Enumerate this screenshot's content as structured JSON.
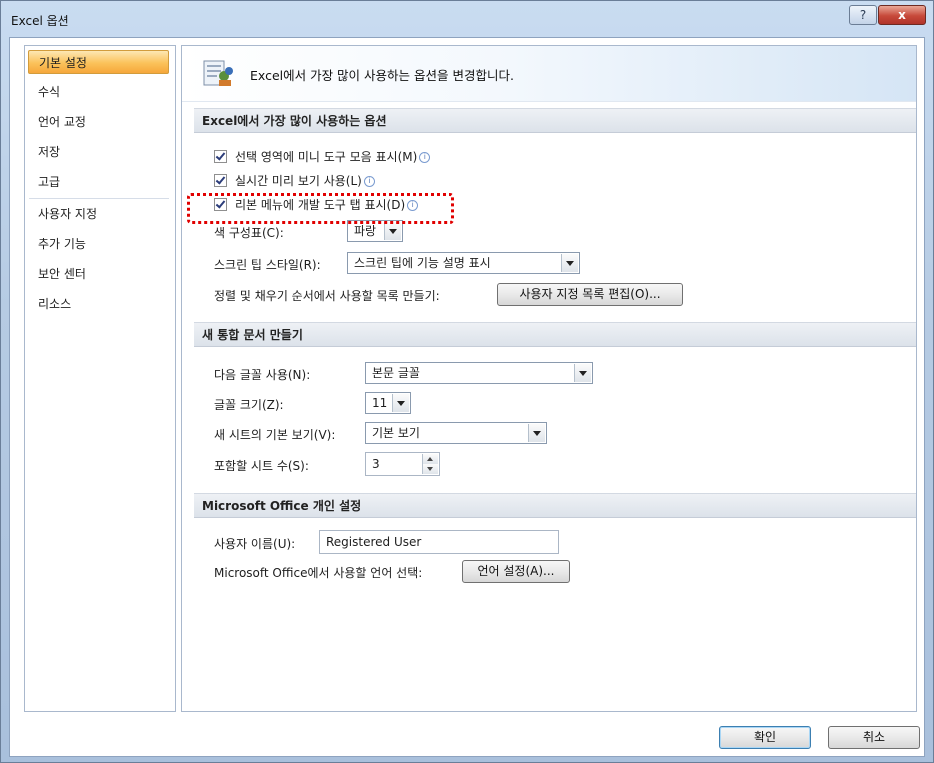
{
  "window": {
    "title": "Excel 옵션",
    "help": "?",
    "close": "x"
  },
  "sidebar": {
    "items": [
      {
        "label": "기본 설정",
        "selected": true
      },
      {
        "label": "수식"
      },
      {
        "label": "언어 교정"
      },
      {
        "label": "저장"
      },
      {
        "label": "고급"
      },
      {
        "label": "사용자 지정"
      },
      {
        "label": "추가 기능"
      },
      {
        "label": "보안 센터"
      },
      {
        "label": "리소스"
      }
    ]
  },
  "banner": {
    "text": "Excel에서 가장 많이 사용하는 옵션을 변경합니다."
  },
  "section1": {
    "header": "Excel에서 가장 많이 사용하는 옵션",
    "mini_toolbar": "선택 영역에 미니 도구 모음 표시(M)",
    "live_preview": "실시간 미리 보기 사용(L)",
    "developer_tab": "리본 메뉴에 개발 도구 탭 표시(D)",
    "color_scheme_label": "색 구성표(C):",
    "color_scheme_value": "파랑",
    "screentip_label": "스크린 팁 스타일(R):",
    "screentip_value": "스크린 팁에 기능 설명 표시",
    "custom_list_label": "정렬 및 채우기 순서에서 사용할 목록 만들기:",
    "custom_list_button": "사용자 지정 목록 편집(O)..."
  },
  "section2": {
    "header": "새 통합 문서 만들기",
    "font_label": "다음 글꼴 사용(N):",
    "font_value": "본문 글꼴",
    "size_label": "글꼴 크기(Z):",
    "size_value": "11",
    "view_label": "새 시트의 기본 보기(V):",
    "view_value": "기본 보기",
    "sheets_label": "포함할 시트 수(S):",
    "sheets_value": "3"
  },
  "section3": {
    "header": "Microsoft Office 개인 설정",
    "username_label": "사용자 이름(U):",
    "username_value": "Registered User",
    "language_label": "Microsoft Office에서 사용할 언어 선택:",
    "language_button": "언어 설정(A)..."
  },
  "footer": {
    "ok": "확인",
    "cancel": "취소"
  },
  "colors": {
    "accent": "#f6a73b",
    "highlight": "#e00000"
  }
}
